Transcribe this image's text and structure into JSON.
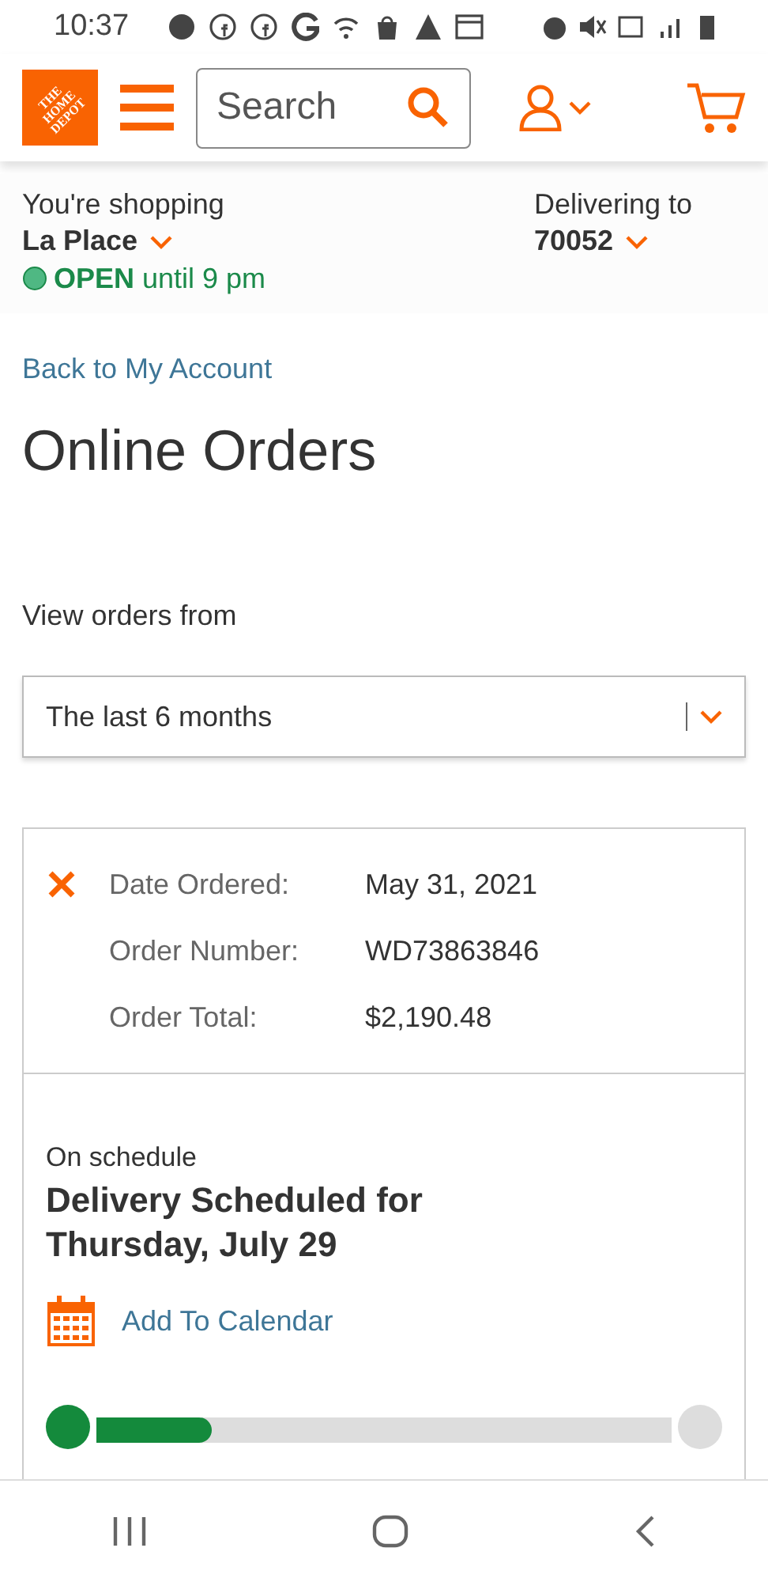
{
  "status_bar": {
    "time": "10:37"
  },
  "header": {
    "logo_text": [
      "THE",
      "HOME",
      "DEPOT"
    ],
    "search": {
      "placeholder": "Search"
    }
  },
  "store": {
    "label": "You're shopping",
    "name": "La Place",
    "open_label": "OPEN",
    "hours": "until 9 pm",
    "delivery_label": "Delivering to",
    "zip": "70052"
  },
  "back_link": "Back to My Account",
  "title": "Online Orders",
  "filter": {
    "label": "View orders from",
    "value": "The last 6 months"
  },
  "order": {
    "expanded": true,
    "fields": [
      {
        "label": "Date Ordered:",
        "value": "May 31, 2021"
      },
      {
        "label": "Order Number:",
        "value": "WD73863846"
      },
      {
        "label": "Order Total:",
        "value": "$2,190.48"
      }
    ],
    "status": "On schedule",
    "delivery": "Delivery Scheduled for Thursday, July 29",
    "calendar_link": "Add To Calendar",
    "progress": {
      "level": 0.2
    }
  }
}
